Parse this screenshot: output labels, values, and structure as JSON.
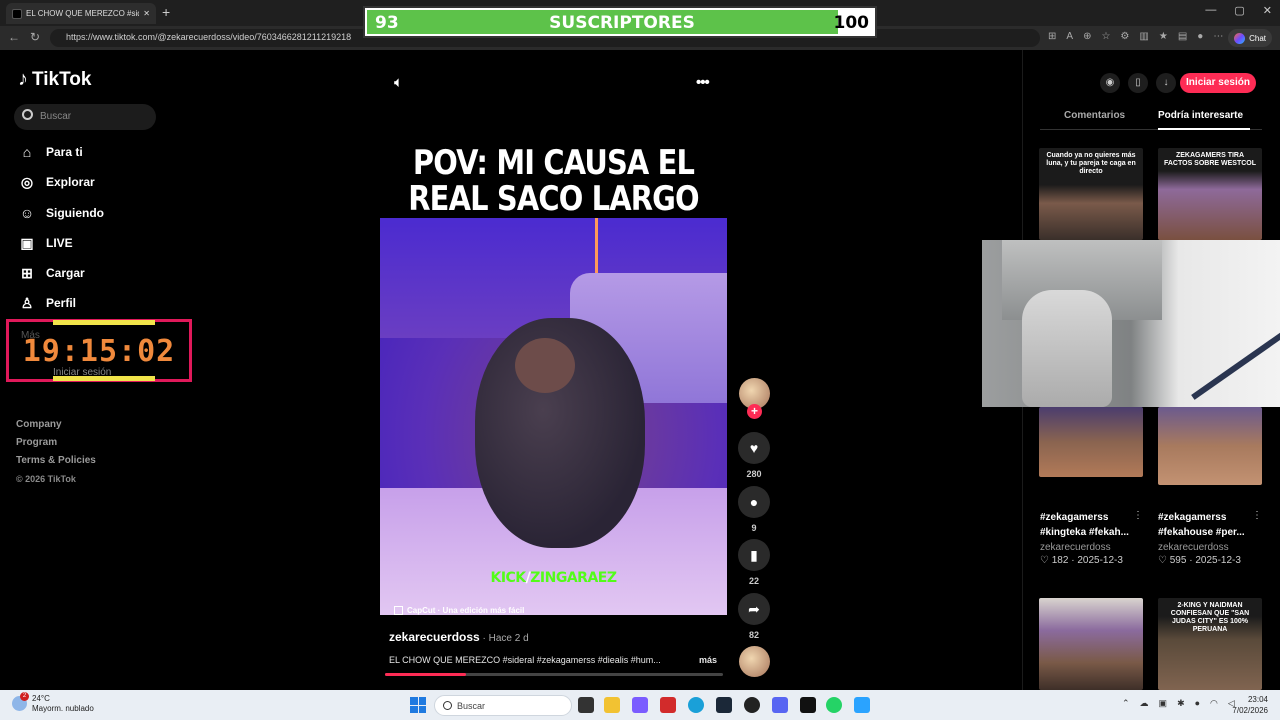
{
  "browser": {
    "tab_title": "EL CHOW QUE MEREZCO #sid",
    "url": "https://www.tiktok.com/@zekarecuerdoss/video/7603466281211219218",
    "chat_label": "Chat",
    "new_tab_icon": "plus-icon"
  },
  "subscriber_overlay": {
    "current": "93",
    "label": "SUSCRIPTORES",
    "goal": "100",
    "progress_fraction": 0.93,
    "fill_color": "#5dc24a"
  },
  "sidebar": {
    "logo": "TikTok",
    "search_placeholder": "Buscar",
    "items": [
      {
        "label": "Para ti",
        "icon": "home-icon"
      },
      {
        "label": "Explorar",
        "icon": "compass-icon"
      },
      {
        "label": "Siguiendo",
        "icon": "user-follow-icon"
      },
      {
        "label": "LIVE",
        "icon": "live-tv-icon"
      },
      {
        "label": "Cargar",
        "icon": "upload-plus-icon"
      },
      {
        "label": "Perfil",
        "icon": "profile-icon"
      }
    ],
    "more_label": "Más",
    "login_label": "Iniciar sesión",
    "footer": [
      "Company",
      "Program",
      "Terms & Policies"
    ],
    "copyright": "© 2026 TikTok"
  },
  "timer_overlay": {
    "time": "19:15:02",
    "border_color": "#e0195a",
    "text_color": "#f0893c"
  },
  "video": {
    "title_line1": "POV: MI CAUSA EL",
    "title_line2": "REAL SACO LARGO",
    "watermark_kick": "KICK",
    "watermark_slash": "/",
    "watermark_name": "ZINGARAEZ",
    "capcut_text": "CapCut · Una edición más fácil",
    "author": "zekarecuerdoss",
    "time_ago": " · Hace 2 d",
    "description": "EL CHOW QUE MEREZCO #sideral #zekagamerss #diealis #hum...",
    "more_label": "más",
    "progress_fraction": 0.24
  },
  "actions": {
    "likes": "280",
    "comments": "9",
    "saves": "22",
    "shares": "82"
  },
  "right_panel": {
    "login_button": "Iniciar sesión",
    "tab_comments": "Comentarios",
    "tab_interest": "Podría interesarte",
    "thumb1_caption": "Cuando ya no quieres más luna, y tu pareja te caga en directo",
    "thumb2_caption": "ZEKAGAMERS TIRA FACTOS SOBRE WESTCOL",
    "thumb5_caption": "2-KING Y NAIDMAN CONFIESAN QUE \"SAN JUDAS CITY\" ES 100% PERUANA",
    "cards": [
      {
        "hashtags": "#zekagamerss #kingteka #fekah...",
        "user": "zekarecuerdoss",
        "likes": "182",
        "date": "2025-12-3"
      },
      {
        "hashtags": "#zekagamerss #fekahouse #per...",
        "user": "zekarecuerdoss",
        "likes": "595",
        "date": "2025-12-3"
      }
    ]
  },
  "taskbar": {
    "weather_temp": "24°C",
    "weather_desc": "Mayorm. nublado",
    "weather_badge": "2",
    "search_placeholder": "Buscar",
    "time": "23:04",
    "date": "7/02/2026"
  }
}
